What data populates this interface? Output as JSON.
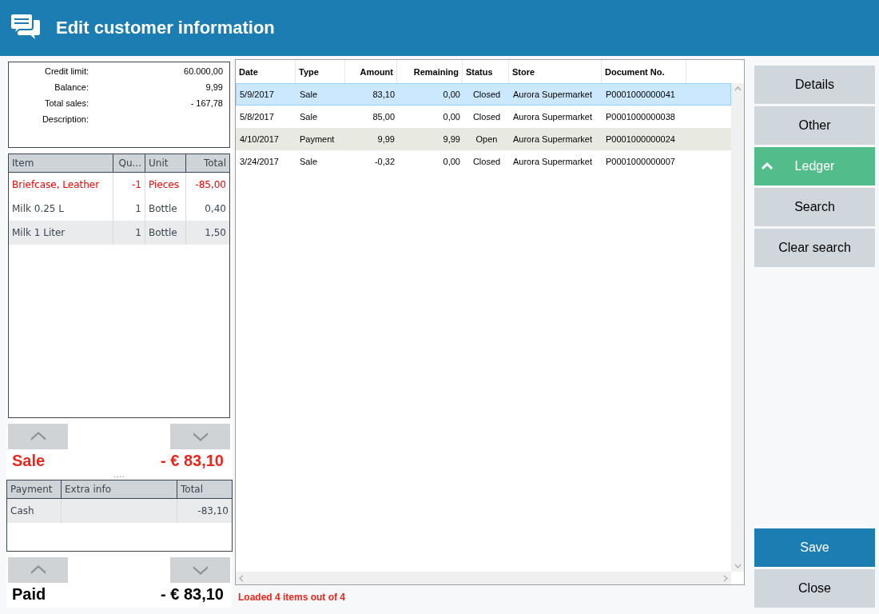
{
  "window": {
    "title": "Edit customer information"
  },
  "summary": [
    {
      "label": "Credit limit:",
      "value": "60.000,00"
    },
    {
      "label": "Balance:",
      "value": "9,99"
    },
    {
      "label": "Total sales:",
      "value": "- 167,78"
    },
    {
      "label": "Description:"
    }
  ],
  "items": {
    "columns": [
      "Item",
      "Qu...",
      "Unit",
      "Total"
    ],
    "rows": [
      {
        "cells": [
          "Briefcase, Leather",
          "-1",
          "Pieces",
          "-85,00"
        ],
        "returned": true,
        "selected": false
      },
      {
        "cells": [
          "Milk 0.25 L",
          "1",
          "Bottle",
          "0,40"
        ],
        "returned": false,
        "selected": false
      },
      {
        "cells": [
          "Milk 1 Liter",
          "1",
          "Bottle",
          "1,50"
        ],
        "returned": false,
        "selected": true
      }
    ]
  },
  "sale_total": {
    "label": "Sale",
    "value": "- € 83,10"
  },
  "splitter": "....",
  "payments": {
    "columns": [
      "Payment",
      "Extra info",
      "Total"
    ],
    "rows": [
      {
        "cells": [
          "Cash",
          "",
          "-83,10"
        ],
        "selected": true
      }
    ]
  },
  "paid_total": {
    "label": "Paid",
    "value": "- € 83,10"
  },
  "ledger": {
    "columns": [
      "Date",
      "Type",
      "Amount",
      "Remaining",
      "Status",
      "Store",
      "Document No."
    ],
    "rows": [
      {
        "cells": [
          "5/9/2017",
          "Sale",
          "83,10",
          "0,00",
          "Closed",
          "Aurora Supermarket",
          "P0001000000041"
        ],
        "selected": true,
        "open": false
      },
      {
        "cells": [
          "5/8/2017",
          "Sale",
          "85,00",
          "0,00",
          "Closed",
          "Aurora Supermarket",
          "P0001000000038"
        ],
        "selected": false,
        "open": false
      },
      {
        "cells": [
          "4/10/2017",
          "Payment",
          "9,99",
          "9,99",
          "Open",
          "Aurora Supermarket",
          "P0001000000024"
        ],
        "selected": false,
        "open": true
      },
      {
        "cells": [
          "3/24/2017",
          "Sale",
          "-0,32",
          "0,00",
          "Closed",
          "Aurora Supermarket",
          "P0001000000007"
        ],
        "selected": false,
        "open": false
      }
    ]
  },
  "status": "Loaded 4 items out of 4",
  "nav": [
    {
      "label": "Details",
      "selected": false
    },
    {
      "label": "Other",
      "selected": false
    },
    {
      "label": "Ledger",
      "selected": true
    },
    {
      "label": "Search",
      "selected": false
    },
    {
      "label": "Clear search",
      "selected": false
    }
  ],
  "actions": [
    {
      "label": "Save",
      "kind": "primary"
    },
    {
      "label": "Close",
      "kind": "secondary"
    }
  ]
}
